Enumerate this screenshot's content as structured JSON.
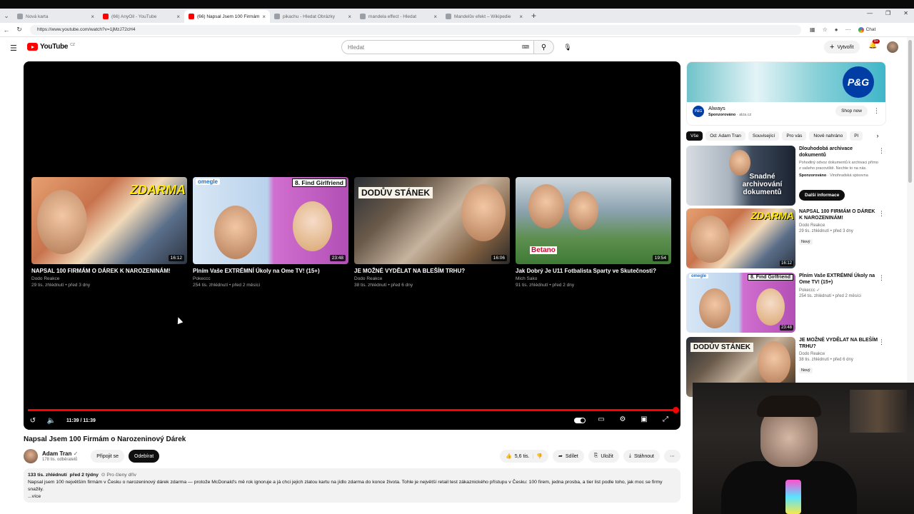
{
  "browser": {
    "tabs": [
      {
        "title": "Nová karta",
        "color": "#9aa0a6",
        "active": false
      },
      {
        "title": "(66) AnyOil - YouTube",
        "color": "#ff0000",
        "active": false
      },
      {
        "title": "(66) Napsal Jsem 100 Firmám o N...",
        "color": "#ff0000",
        "active": true
      },
      {
        "title": "pikachu - Hledat Obrázky",
        "color": "#9aa0a6",
        "active": false
      },
      {
        "title": "mandela effect - Hledat",
        "color": "#9aa0a6",
        "active": false
      },
      {
        "title": "Mandelův efekt – Wikipedie",
        "color": "#9aa0a6",
        "active": false
      }
    ],
    "url": "https://www.youtube.com/watch?v=1jMzJ72cH4",
    "chat_label": "Chat"
  },
  "header": {
    "logo_text": "YouTube",
    "logo_region": "CZ",
    "search_placeholder": "Hledat",
    "create_label": "Vytvořit",
    "notifications_badge": "9+"
  },
  "player": {
    "endcards": [
      {
        "title": "NAPSAL 100 FIRMÁM O DÁREK K NAROZENINÁM!",
        "channel": "Dodo Reakce",
        "meta": "29 tis. zhlédnutí • před 3 dny",
        "duration": "16:12",
        "badge": "ZDARMA"
      },
      {
        "title": "Plním Vaše EXTRÉMNÍ Úkoly na Ome TV! (15+)",
        "channel": "Pokeccc",
        "meta": "254 tis. zhlédnutí • před 2 měsíci",
        "duration": "23:48",
        "badge": "8. Find Girlfriend",
        "badge2": "omegle"
      },
      {
        "title": "JE MOŽNÉ VYDĚLAT NA BLEŠÍM TRHU?",
        "channel": "Dodo Reakce",
        "meta": "38 tis. zhlédnutí • před 6 dny",
        "duration": "16:06",
        "badge": "DODŮV STÁNEK"
      },
      {
        "title": "Jak Dobrý Je U11 Fotbalista Sparty ve Skutečnosti?",
        "channel": "Mich Sako",
        "meta": "91 tis. zhlédnutí • před 2 dny",
        "duration": "19:54",
        "badge": "Betano"
      }
    ],
    "time": "11:39 / 11:39",
    "progress": 1.0
  },
  "video": {
    "title": "Napsal Jsem 100 Firmám o Narozeninový Dárek",
    "channel": "Adam Tran",
    "subscribers": "178 tis. odběratelů",
    "join_label": "Připojit se",
    "subscribe_label": "Odebírat",
    "likes": "5,6 tis.",
    "share_label": "Sdílet",
    "save_label": "Uložit",
    "download_label": "Stáhnout",
    "views": "133 tis. zhlédnutí",
    "age": "před 2 týdny",
    "members": "Pro členy dřív",
    "description": "Napsal jsem 100 největším firmám v Česku o narozeninový dárek zdarma — protože McDonald's mě rok ignoruje a já chci jejich zlatou kartu na jídlo zdarma do konce života. Tohle je největší retail test zákaznického přístupu v Česku: 100 firem, jedna prosba, a tier list podle toho, jak moc se firmy snažily.",
    "more_label": "...více"
  },
  "sidebar": {
    "ad": {
      "brand": "P&G",
      "name": "Always",
      "sponsored": "Sponzorováno",
      "domain": "alza.cz",
      "shop_label": "Shop now"
    },
    "chips": [
      "Vše",
      "Od: Adam Tran",
      "Související",
      "Pro vás",
      "Nově nahráno",
      "Pl"
    ],
    "promo": {
      "title": "Dlouhodobá archivace dokumentů",
      "text": "Pohodlný odvoz dokumentů k archivaci přímo z vašeho pracoviště. Nechte to na nás.",
      "sponsored": "Sponzorováno",
      "advertiser": "Vinohradská spisovna",
      "button": "Další informace",
      "overlay": "Snadné archivování dokumentů"
    },
    "recs": [
      {
        "title": "NAPSAL 100 FIRMÁM O DÁREK K NAROZENINÁM!",
        "channel": "Dodo Reakce",
        "stats": "29 tis. zhlédnutí • před 3 dny",
        "new": "Nový",
        "duration": "16:12"
      },
      {
        "title": "Plním Vaše EXTRÉMNÍ Úkoly na Ome TV! (15+)",
        "channel": "Pokeccc",
        "stats": "254 tis. zhlédnutí • před 2 měsíci",
        "new": "",
        "duration": "23:48"
      },
      {
        "title": "JE MOŽNÉ VYDĚLAT NA BLEŠÍM TRHU?",
        "channel": "Dodo Reakce",
        "stats": "38 tis. zhlédnutí • před 6 dny",
        "new": "Nový",
        "duration": ""
      }
    ]
  }
}
